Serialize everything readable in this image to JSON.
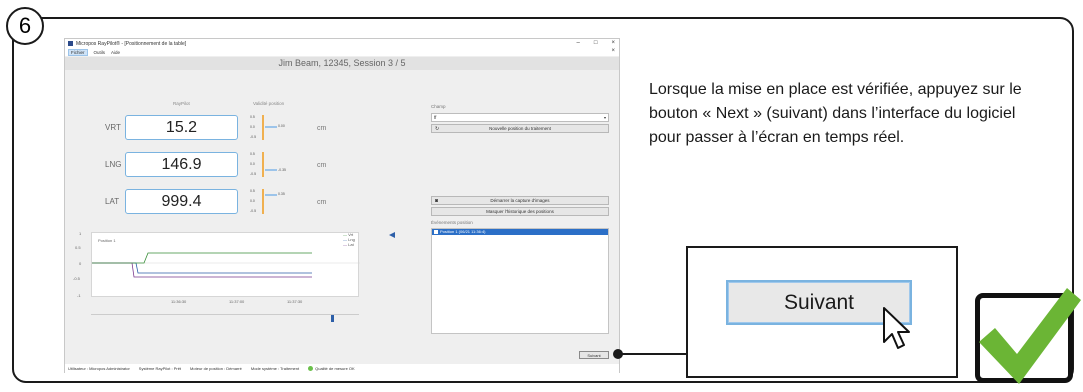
{
  "step_number": "6",
  "app": {
    "window_title": "Micropos RayPilot® - [Positionnement de la table]",
    "window_controls": [
      "–",
      "□",
      "×"
    ],
    "menu": [
      "Fichier",
      "Outils",
      "Aide"
    ],
    "close_symbol": "×",
    "session_header": "Jim Beam, 12345, Session 3 / 5",
    "column_headers": {
      "raypilot": "RayPilot",
      "validity": "Validité position"
    },
    "rows": [
      {
        "axis": "VRT",
        "value": "15.2",
        "unit": "cm",
        "ticks": [
          "0.5",
          "0.0",
          "-0.5"
        ],
        "marker_value": "0.00"
      },
      {
        "axis": "LNG",
        "value": "146.9",
        "unit": "cm",
        "ticks": [
          "0.5",
          "0.0",
          "-0.5"
        ],
        "marker_value": "-0.35"
      },
      {
        "axis": "LAT",
        "value": "999.4",
        "unit": "cm",
        "ticks": [
          "0.5",
          "0.0",
          "-0.5"
        ],
        "marker_value": "0.35"
      }
    ],
    "chart": {
      "yticks": [
        "1",
        "0.5",
        "0",
        "-0.5",
        "-1"
      ],
      "xticks": [
        "11:36:30",
        "11:37:00",
        "11:37:30"
      ],
      "series_label": "Position 1",
      "legend": [
        "Vrt",
        "Lng",
        "Lat"
      ],
      "colors": {
        "vrt": "#3a8f3a",
        "lng": "#2d5fa8",
        "lat": "#7a3a8f"
      }
    },
    "field": {
      "label": "Champ",
      "selected": "ff",
      "new_position_button": "Nouvelle position du traitement"
    },
    "capture_button": "Démarrer la capture d'images",
    "hide_history_button": "Masquer l'historique des positions",
    "events_label": "Événements position",
    "events_row": "Position 1 (06/21 11:36:4)",
    "small_next_button": "Suivant",
    "status": {
      "user": "Utilisateur : Micropos Administrator",
      "system": "Système RayPilot : Prêt",
      "motor": "Moteur de position : Démarré",
      "mode": "Mode système : Traitement",
      "quality": "Qualité de mesure OK"
    }
  },
  "instruction_text": "Lorsque la mise en place est vérifiée, appuyez sur le bouton « Next » (suivant) dans l’interface du logiciel pour passer à l’écran en temps réel.",
  "zoom_button_label": "Suivant",
  "accent_color": "#7ab3e0",
  "check_color": "#6bb535"
}
